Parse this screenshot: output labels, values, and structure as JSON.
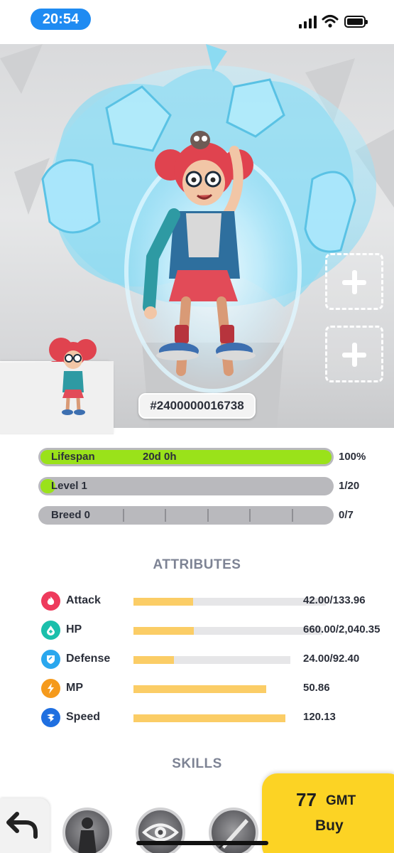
{
  "status_bar": {
    "time": "20:54",
    "signal_icon": "cellular-signal-icon",
    "wifi_icon": "wifi-icon",
    "battery_icon": "battery-icon"
  },
  "hero": {
    "token_id": "#2400000016738",
    "add_slot_icon": "plus-icon"
  },
  "progress": [
    {
      "label": "Lifespan",
      "middle": "20d 0h",
      "value": "100%",
      "fraction": 1.0,
      "color": "#9ae21a"
    },
    {
      "label": "Level 1",
      "value": "1/20",
      "fraction": 0.05,
      "color": "#9ae21a"
    },
    {
      "label": "Breed 0",
      "value": "0/7",
      "fraction": 0.0,
      "segments": 7
    }
  ],
  "attributes_title": "ATTRIBUTES",
  "attributes": [
    {
      "name": "Attack",
      "value": "42.00/133.96",
      "fraction": 0.31,
      "icon": "attack-flame-icon",
      "color": "#ee3a5c"
    },
    {
      "name": "HP",
      "value": "660.00/2,040.35",
      "fraction": 0.32,
      "icon": "hp-plus-drop-icon",
      "color": "#1bbfab"
    },
    {
      "name": "Defense",
      "value": "24.00/92.40",
      "fraction": 0.26,
      "icon": "defense-shield-icon",
      "color": "#2aa7ee"
    },
    {
      "name": "MP",
      "value": "50.86",
      "fraction": 0.94,
      "icon": "mp-lightning-icon",
      "color": "#f59a1c"
    },
    {
      "name": "Speed",
      "value": "120.13",
      "fraction": 1.0,
      "icon": "speed-wing-icon",
      "color": "#1f6fe0"
    }
  ],
  "skills_title": "SKILLS",
  "skills": [
    "skill-silhouette-icon",
    "skill-eye-icon",
    "skill-blade-icon"
  ],
  "back_icon": "back-arrow-icon",
  "buy": {
    "price": "77",
    "currency": "GMT",
    "label": "Buy"
  }
}
